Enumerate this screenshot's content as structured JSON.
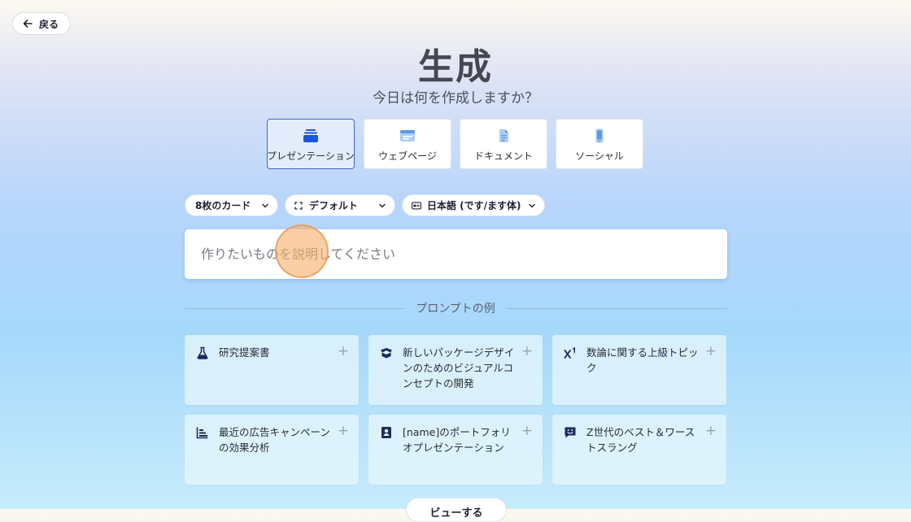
{
  "back_button": {
    "label": "戻る"
  },
  "header": {
    "title": "生成",
    "subtitle": "今日は何を作成しますか？"
  },
  "content_types": [
    {
      "label": "プレゼンテーション",
      "icon": "presentation-icon",
      "selected": true
    },
    {
      "label": "ウェブページ",
      "icon": "webpage-icon",
      "selected": false
    },
    {
      "label": "ドキュメント",
      "icon": "document-icon",
      "selected": false
    },
    {
      "label": "ソーシャル",
      "icon": "mobile-icon",
      "selected": false
    }
  ],
  "options": {
    "card_count": "8枚のカード",
    "aspect": "デフォルト",
    "language": "日本語 (です/ます体)"
  },
  "prompt": {
    "placeholder": "作りたいものを説明してください",
    "value": ""
  },
  "examples": {
    "heading": "プロンプトの例",
    "items": [
      {
        "text": "研究提案書",
        "icon": "flask-icon"
      },
      {
        "text": "新しいパッケージデザインのためのビジュアルコンセプトの開発",
        "icon": "box-icon"
      },
      {
        "text": "数論に関する上級トピック",
        "icon": "superscript-icon"
      },
      {
        "text": "最近の広告キャンペーンの効果分析",
        "icon": "bar-chart-icon"
      },
      {
        "text": "[name]のポートフォリオプレゼンテーション",
        "icon": "portfolio-icon"
      },
      {
        "text": "Z世代のベスト＆ワーストスラング",
        "icon": "chat-smile-icon"
      }
    ],
    "plus_glyph": "+"
  },
  "see_all": {
    "label": "ビューする"
  },
  "colors": {
    "accent": "#1a56db",
    "selected_tab_bg": "#e3ecfa",
    "icon_dark": "#1e2a5a"
  }
}
